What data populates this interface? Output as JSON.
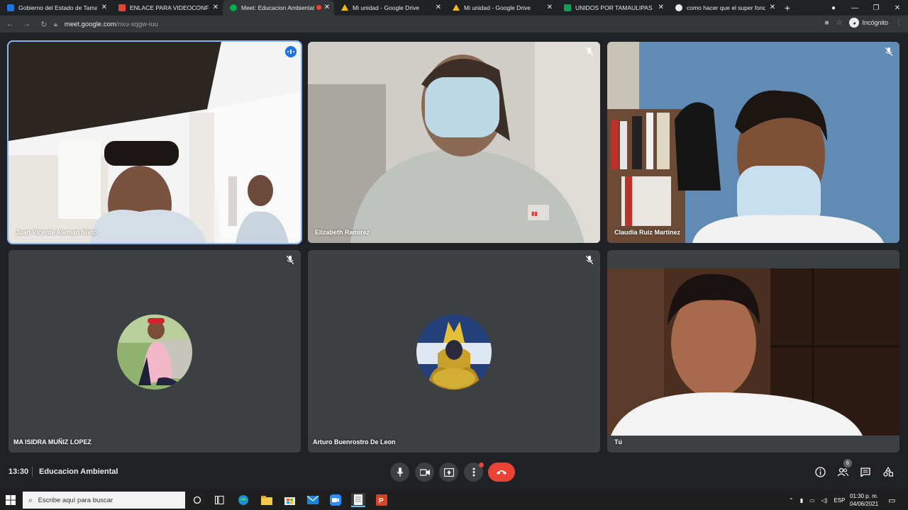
{
  "browser": {
    "tabs": [
      {
        "label": "Gobierno del Estado de Tamaulipas",
        "favicon_color": "#1a73e8",
        "active": false,
        "recording": false
      },
      {
        "label": "ENLACE PARA VIDEOCONFERENCIA",
        "favicon_color": "#ea4335",
        "active": false,
        "recording": false
      },
      {
        "label": "Meet: Educacion Ambiental",
        "favicon_color": "#00ac47",
        "active": true,
        "recording": true
      },
      {
        "label": "Mi unidad - Google Drive",
        "favicon_color": "#fbbc04",
        "active": false,
        "recording": false
      },
      {
        "label": "Mi unidad - Google Drive",
        "favicon_color": "#fbbc04",
        "active": false,
        "recording": false
      },
      {
        "label": "UNIDOS POR TAMAULIPAS - CO",
        "favicon_color": "#0f9d58",
        "active": false,
        "recording": false
      },
      {
        "label": "como hacer que el super fondo",
        "favicon_color": "#e8eaed",
        "active": false,
        "recording": false
      }
    ],
    "url_host": "meet.google.com",
    "url_path": "/nxu-xqgw-iuu",
    "incognito_label": "Incógnito"
  },
  "meeting": {
    "time": "13:30",
    "title": "Educacion Ambiental",
    "participant_count": "6",
    "participants": [
      {
        "name": "Juan Vicente Aleman Nieto",
        "type": "video",
        "speaking": true,
        "muted": false
      },
      {
        "name": "Elizabeth Ramirez",
        "type": "video",
        "speaking": false,
        "muted": true
      },
      {
        "name": "Claudia Ruiz Martinez",
        "type": "video",
        "speaking": false,
        "muted": true
      },
      {
        "name": "MA ISIDRA MUÑIZ LOPEZ",
        "type": "avatar",
        "speaking": false,
        "muted": true
      },
      {
        "name": "Arturo Buenrostro De Leon",
        "type": "avatar",
        "speaking": false,
        "muted": true
      },
      {
        "name": "Tú",
        "type": "video",
        "speaking": false,
        "muted": false
      }
    ],
    "controls": [
      "mic-icon",
      "camera-icon",
      "present-icon",
      "more-options-icon",
      "end-call-icon"
    ],
    "right_controls": [
      "info-icon",
      "people-icon",
      "chat-icon",
      "activities-icon"
    ]
  },
  "taskbar": {
    "search_placeholder": "Escribe aquí para buscar",
    "language": "ESP",
    "clock_time": "01:30 p. m.",
    "clock_date": "04/06/2021"
  },
  "colors": {
    "accent_blue": "#8ab4f8",
    "end_call_red": "#ea4335",
    "tile_bg": "#3c4043",
    "page_bg": "#202124"
  }
}
